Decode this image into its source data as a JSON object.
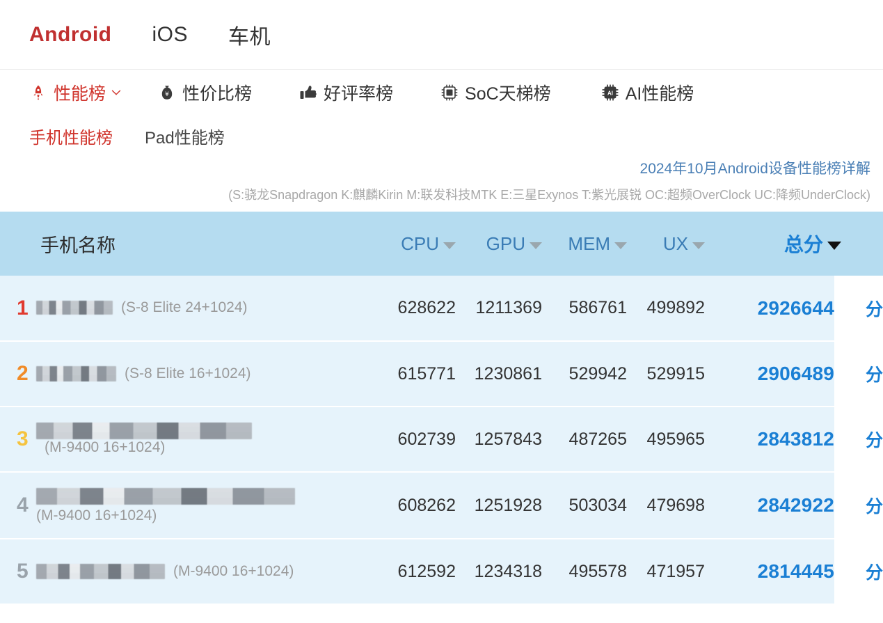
{
  "platform_tabs": [
    {
      "label": "Android",
      "active": true
    },
    {
      "label": "iOS",
      "active": false
    },
    {
      "label": "车机",
      "active": false
    }
  ],
  "category_tabs": [
    {
      "label": "性能榜",
      "icon": "rocket-icon",
      "active": true,
      "has_dropdown": true
    },
    {
      "label": "性价比榜",
      "icon": "money-bag-icon",
      "active": false,
      "has_dropdown": false
    },
    {
      "label": "好评率榜",
      "icon": "thumbs-up-icon",
      "active": false,
      "has_dropdown": false
    },
    {
      "label": "SoC天梯榜",
      "icon": "chip-icon",
      "active": false,
      "has_dropdown": false
    },
    {
      "label": "AI性能榜",
      "icon": "ai-chip-icon",
      "active": false,
      "has_dropdown": false
    }
  ],
  "sub_tabs": [
    {
      "label": "手机性能榜",
      "active": true
    },
    {
      "label": "Pad性能榜",
      "active": false
    }
  ],
  "detail_link": "2024年10月Android设备性能榜详解",
  "legend": "(S:骁龙Snapdragon K:麒麟Kirin M:联发科技MTK E:三星Exynos T:紫光展锐 OC:超频OverClock UC:降频UnderClock)",
  "table": {
    "headers": {
      "name": "手机名称",
      "cpu": "CPU",
      "gpu": "GPU",
      "mem": "MEM",
      "ux": "UX",
      "total": "总分"
    },
    "unit": "分",
    "rows": [
      {
        "rank": "1",
        "rank_color": "#e03a2f",
        "device": "",
        "spec": "(S-8 Elite 24+1024)",
        "spec_wraps": false,
        "redact_width": 110,
        "cpu": "628622",
        "gpu": "1211369",
        "mem": "586761",
        "ux": "499892",
        "total": "2926644"
      },
      {
        "rank": "2",
        "rank_color": "#f08b28",
        "device": "",
        "spec": "(S-8 Elite 16+1024)",
        "spec_wraps": false,
        "redact_width": 115,
        "cpu": "615771",
        "gpu": "1230861",
        "mem": "529942",
        "ux": "529915",
        "total": "2906489"
      },
      {
        "rank": "3",
        "rank_color": "#f5c33f",
        "device": "",
        "spec": "(M-9400 16+1024)",
        "spec_wraps": false,
        "redact_width": 310,
        "cpu": "602739",
        "gpu": "1257843",
        "mem": "487265",
        "ux": "495965",
        "total": "2843812"
      },
      {
        "rank": "4",
        "rank_color": "#9aa3ab",
        "device": "",
        "spec": "(M-9400 16+1024)",
        "spec_wraps": true,
        "redact_width": 372,
        "cpu": "608262",
        "gpu": "1251928",
        "mem": "503034",
        "ux": "479698",
        "total": "2842922"
      },
      {
        "rank": "5",
        "rank_color": "#9aa3ab",
        "device": "",
        "spec": "(M-9400 16+1024)",
        "spec_wraps": false,
        "redact_width": 185,
        "cpu": "612592",
        "gpu": "1234318",
        "mem": "495578",
        "ux": "471957",
        "total": "2814445"
      }
    ]
  },
  "colors": {
    "accent_red": "#d0342c",
    "link_blue": "#4a7fb5",
    "score_blue": "#1a7fd4",
    "header_bg": "#b5dcf0",
    "row_bg": "#e6f3fb"
  }
}
